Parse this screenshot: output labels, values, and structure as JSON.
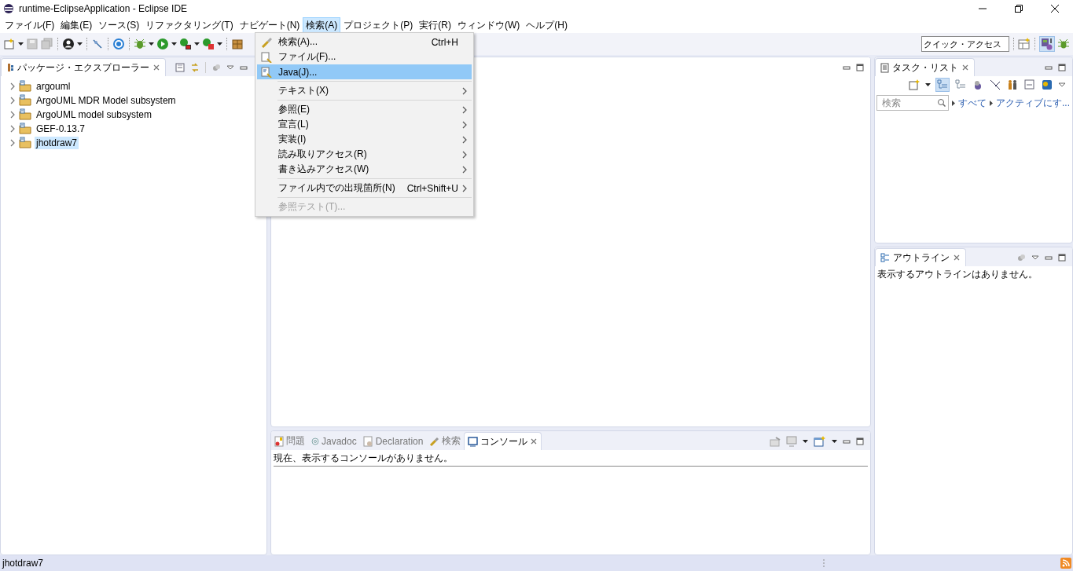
{
  "window": {
    "title": "runtime-EclipseApplication - Eclipse IDE"
  },
  "menubar": {
    "items": [
      {
        "label": "ファイル(F)",
        "selected": false
      },
      {
        "label": "編集(E)",
        "selected": false
      },
      {
        "label": "ソース(S)",
        "selected": false
      },
      {
        "label": "リファクタリング(T)",
        "selected": false
      },
      {
        "label": "ナビゲート(N)",
        "selected": false
      },
      {
        "label": "検索(A)",
        "selected": true
      },
      {
        "label": "プロジェクト(P)",
        "selected": false
      },
      {
        "label": "実行(R)",
        "selected": false
      },
      {
        "label": "ウィンドウ(W)",
        "selected": false
      },
      {
        "label": "ヘルプ(H)",
        "selected": false
      }
    ]
  },
  "toolbar": {
    "quick_access": {
      "placeholder": "クイック・アクセス"
    }
  },
  "package_explorer": {
    "title": "パッケージ・エクスプローラー",
    "items": [
      {
        "label": "argouml",
        "selected": false
      },
      {
        "label": "ArgoUML MDR Model subsystem",
        "selected": false
      },
      {
        "label": "ArgoUML model subsystem",
        "selected": false
      },
      {
        "label": "GEF-0.13.7",
        "selected": false
      },
      {
        "label": "jhotdraw7",
        "selected": true
      }
    ]
  },
  "search_menu": {
    "items": [
      {
        "kind": "item",
        "label": "検索(A)...",
        "shortcut": "Ctrl+H",
        "selected": false,
        "disabled": false
      },
      {
        "kind": "item",
        "label": "ファイル(F)...",
        "selected": false,
        "disabled": false
      },
      {
        "kind": "item",
        "label": "Java(J)...",
        "selected": true,
        "disabled": false
      },
      {
        "kind": "separator"
      },
      {
        "kind": "submenu",
        "label": "テキスト(X)",
        "selected": false,
        "disabled": false
      },
      {
        "kind": "separator"
      },
      {
        "kind": "submenu",
        "label": "参照(E)",
        "selected": false,
        "disabled": false
      },
      {
        "kind": "submenu",
        "label": "宣言(L)",
        "selected": false,
        "disabled": false
      },
      {
        "kind": "submenu",
        "label": "実装(I)",
        "selected": false,
        "disabled": false
      },
      {
        "kind": "submenu",
        "label": "読み取りアクセス(R)",
        "selected": false,
        "disabled": false
      },
      {
        "kind": "submenu",
        "label": "書き込みアクセス(W)",
        "selected": false,
        "disabled": false
      },
      {
        "kind": "separator"
      },
      {
        "kind": "submenu",
        "label": "ファイル内での出現箇所(N)",
        "shortcut": "Ctrl+Shift+U",
        "selected": false,
        "disabled": false
      },
      {
        "kind": "separator"
      },
      {
        "kind": "item",
        "label": "参照テスト(T)...",
        "selected": false,
        "disabled": true
      }
    ]
  },
  "task_list": {
    "title": "タスク・リスト",
    "search": {
      "placeholder": "検索"
    },
    "filters": [
      "すべて",
      "アクティブにす..."
    ]
  },
  "outline": {
    "title": "アウトライン",
    "message": "表示するアウトラインはありません。"
  },
  "console": {
    "tabs": [
      {
        "label": "問題",
        "selected": false
      },
      {
        "label": "Javadoc",
        "selected": false
      },
      {
        "label": "Declaration",
        "selected": false
      },
      {
        "label": "検索",
        "selected": false
      },
      {
        "label": "コンソール",
        "selected": true
      }
    ],
    "message": "現在、表示するコンソールがありません。"
  },
  "status_bar": {
    "text": "jhotdraw7"
  }
}
